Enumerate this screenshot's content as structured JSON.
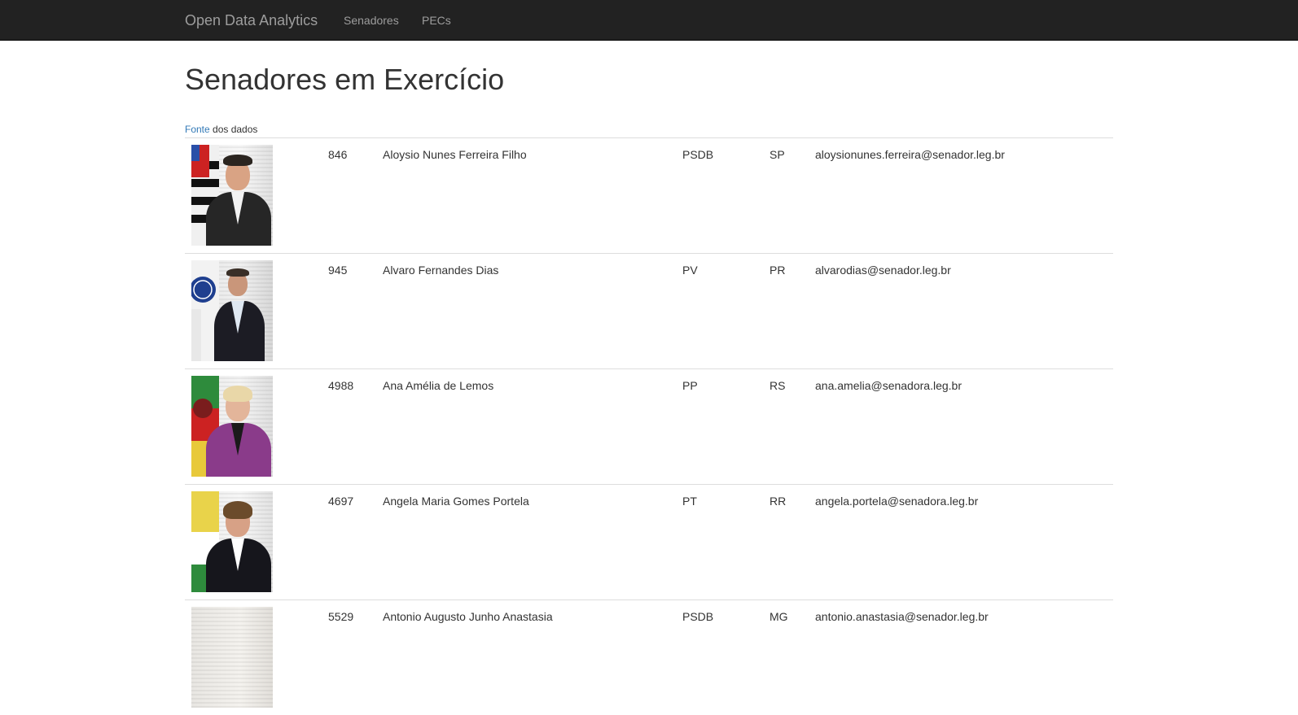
{
  "navbar": {
    "brand": "Open Data Analytics",
    "links": [
      "Senadores",
      "PECs"
    ]
  },
  "page": {
    "title": "Senadores em Exercício",
    "source_link": "Fonte",
    "source_text": " dos dados"
  },
  "senators": [
    {
      "code": "846",
      "name": "Aloysio Nunes Ferreira Filho",
      "party": "PSDB",
      "uf": "SP",
      "email": "aloysionunes.ferreira@senador.leg.br"
    },
    {
      "code": "945",
      "name": "Alvaro Fernandes Dias",
      "party": "PV",
      "uf": "PR",
      "email": "alvarodias@senador.leg.br"
    },
    {
      "code": "4988",
      "name": "Ana Amélia de Lemos",
      "party": "PP",
      "uf": "RS",
      "email": "ana.amelia@senadora.leg.br"
    },
    {
      "code": "4697",
      "name": "Angela Maria Gomes Portela",
      "party": "PT",
      "uf": "RR",
      "email": "angela.portela@senadora.leg.br"
    },
    {
      "code": "5529",
      "name": "Antonio Augusto Junho Anastasia",
      "party": "PSDB",
      "uf": "MG",
      "email": "antonio.anastasia@senador.leg.br"
    }
  ],
  "colors": {
    "navbar_bg": "#222222",
    "nav_text": "#9d9d9d",
    "link": "#337ab7",
    "row_border": "#dddddd"
  }
}
